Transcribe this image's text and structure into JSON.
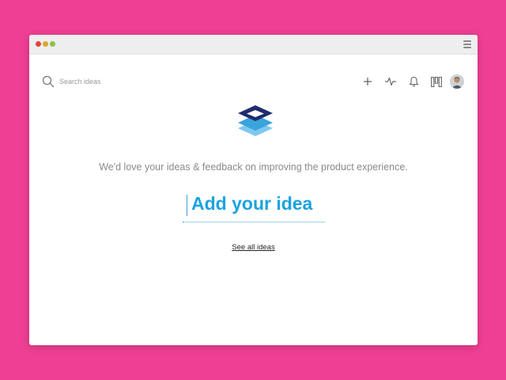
{
  "colors": {
    "background": "#ee3f93",
    "accent": "#1aa3e0",
    "window_dot_red": "#e0443e",
    "window_dot_yellow": "#d7a82b",
    "window_dot_green": "#8bc34a"
  },
  "window": {
    "controls": [
      "close",
      "minimize",
      "zoom"
    ],
    "menu_icon": "hamburger-menu-icon"
  },
  "search": {
    "icon": "search-icon",
    "placeholder": "Search ideas"
  },
  "toolbar": {
    "items": [
      {
        "name": "add-icon"
      },
      {
        "name": "activity-icon"
      },
      {
        "name": "bell-icon"
      },
      {
        "name": "board-icon"
      },
      {
        "name": "avatar"
      }
    ]
  },
  "main": {
    "logo": "stacked-layers-logo",
    "tagline": "We'd love your ideas & feedback on improving the product experience.",
    "idea_input_placeholder": "Add your idea",
    "see_all_link": "See all ideas"
  },
  "chat": {
    "icon": "chat-icon"
  }
}
